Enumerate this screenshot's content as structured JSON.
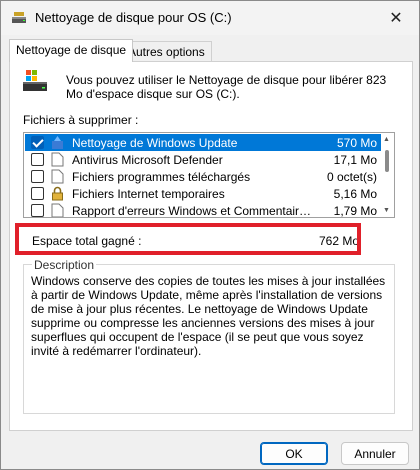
{
  "window": {
    "title": "Nettoyage de disque pour OS (C:)",
    "close_glyph": "✕"
  },
  "tabs": [
    {
      "label": "Nettoyage de disque",
      "active": true
    },
    {
      "label": "Autres options",
      "active": false
    }
  ],
  "intro": {
    "text": "Vous pouvez utiliser le Nettoyage de disque pour libérer 823 Mo d'espace disque sur OS (C:)."
  },
  "files": {
    "label": "Fichiers à supprimer :",
    "items": [
      {
        "name": "Nettoyage de Windows Update",
        "size": "570 Mo",
        "checked": true,
        "selected": true,
        "icon": "windows-update-icon"
      },
      {
        "name": "Antivirus Microsoft Defender",
        "size": "17,1 Mo",
        "checked": false,
        "selected": false,
        "icon": "file-icon"
      },
      {
        "name": "Fichiers programmes téléchargés",
        "size": "0 octet(s)",
        "checked": false,
        "selected": false,
        "icon": "file-icon"
      },
      {
        "name": "Fichiers Internet temporaires",
        "size": "5,16 Mo",
        "checked": false,
        "selected": false,
        "icon": "lock-icon"
      },
      {
        "name": "Rapport d'erreurs Windows et Commentaires e...",
        "size": "1,79 Mo",
        "checked": false,
        "selected": false,
        "icon": "file-icon"
      }
    ]
  },
  "total": {
    "label": "Espace total gagné :",
    "value": "762 Mo"
  },
  "description": {
    "legend": "Description",
    "text": "Windows conserve des copies de toutes les mises à jour installées à partir de Windows Update, même après l'installation de versions de mise à jour plus récentes. Le nettoyage de Windows Update supprime ou compresse les anciennes versions des mises à jour superflues qui occupent de l'espace (il se peut que vous soyez invité à redémarrer l'ordinateur)."
  },
  "buttons": {
    "ok": "OK",
    "cancel": "Annuler"
  },
  "colors": {
    "selection": "#0078d7",
    "highlight_box": "#e0202a",
    "checkbox_checked": "#005fb8"
  }
}
